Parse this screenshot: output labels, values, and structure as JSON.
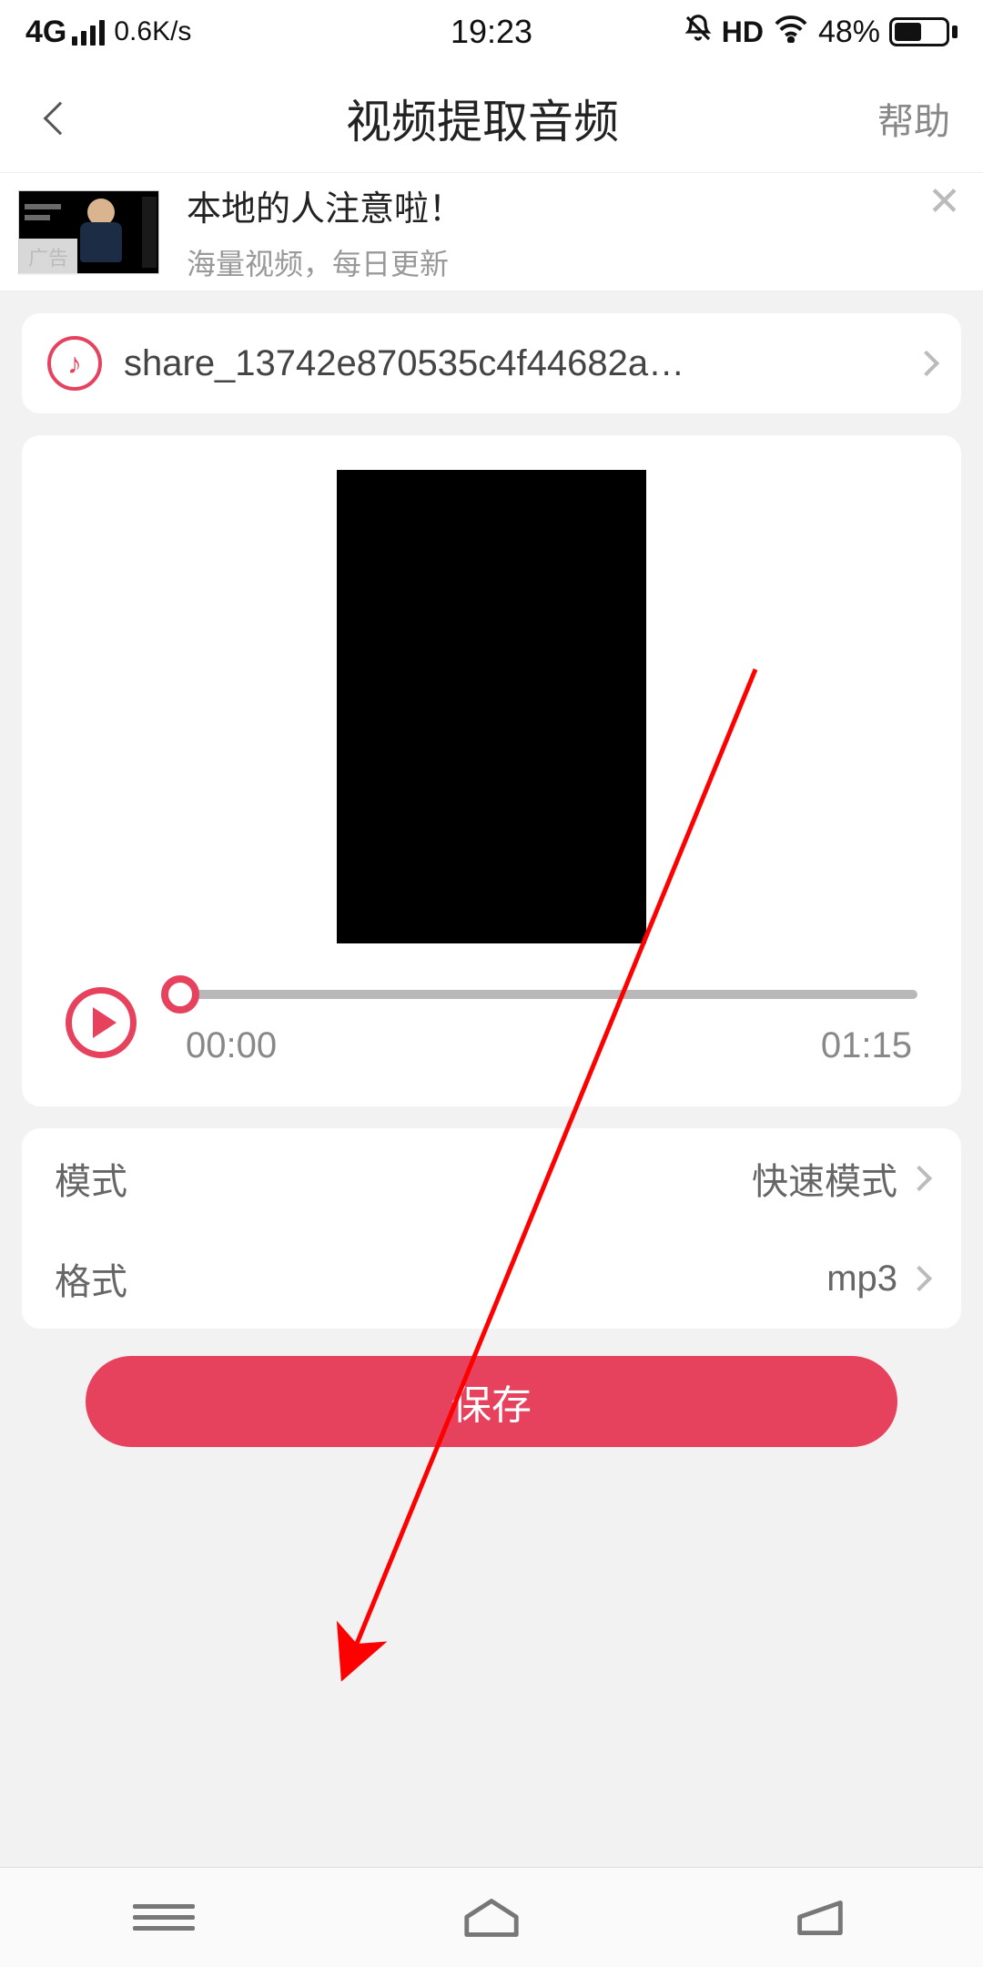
{
  "statusbar": {
    "network_type": "4G",
    "speed": "0.6K/s",
    "clock": "19:23",
    "hd_label": "HD",
    "battery_pct": "48%"
  },
  "header": {
    "title": "视频提取音频",
    "help_label": "帮助"
  },
  "ad": {
    "title": "本地的人注意啦！",
    "subtitle": "海量视频，每日更新",
    "badge": "广告"
  },
  "file": {
    "name": "share_13742e870535c4f44682a…"
  },
  "player": {
    "current_time": "00:00",
    "duration": "01:15"
  },
  "settings": {
    "mode_label": "模式",
    "mode_value": "快速模式",
    "format_label": "格式",
    "format_value": "mp3"
  },
  "actions": {
    "save_label": "保存"
  },
  "colors": {
    "accent": "#e6425e"
  }
}
